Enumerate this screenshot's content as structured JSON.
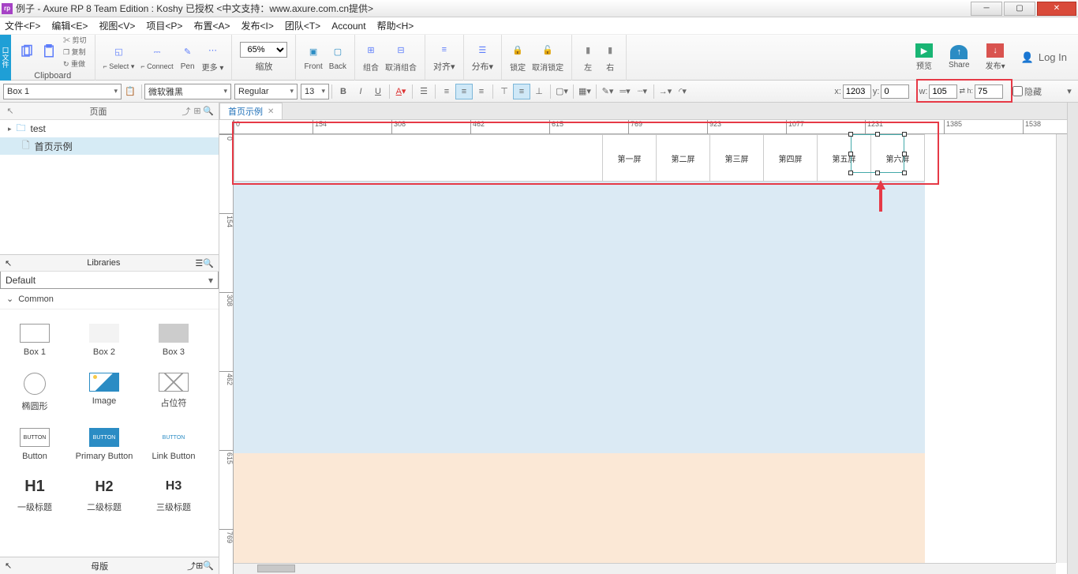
{
  "title": "例子 - Axure RP 8 Team Edition : Koshy 已授权    <中文支持：www.axure.com.cn提供>",
  "appicon": "rp",
  "menu": [
    "文件<F>",
    "编辑<E>",
    "视图<V>",
    "项目<P>",
    "布置<A>",
    "发布<I>",
    "团队<T>",
    "Account",
    "帮助<H>"
  ],
  "toolbar1": {
    "sidelabel": "口文件",
    "clipboard": "Clipboard",
    "clip_items": [
      "剪切",
      "复制",
      "重做"
    ],
    "select": "Select",
    "connect": "Connect",
    "pen": "Pen",
    "more": "更多 ▾",
    "zoom": "65%",
    "zoomlbl": "缩放",
    "front": "Front",
    "back": "Back",
    "group": "组合",
    "ungroup": "取消组合",
    "align": "对齐▾",
    "distribute": "分布▾",
    "lock": "锁定",
    "unlock": "取消锁定",
    "left": "左",
    "right": "右",
    "preview": "预览",
    "share": "Share",
    "publish": "发布▾",
    "login": "Log In"
  },
  "toolbar2": {
    "shape": "Box 1",
    "font": "微软雅黑",
    "weight": "Regular",
    "size": "13",
    "x_lbl": "x:",
    "x": "1203",
    "y_lbl": "y:",
    "y": "0",
    "w_lbl": "w:",
    "w": "105",
    "h_lbl": "h:",
    "h": "75",
    "hidden": "隐藏"
  },
  "pages": {
    "title": "页面",
    "items": [
      {
        "type": "folder",
        "name": "test"
      },
      {
        "type": "page",
        "name": "首页示例",
        "selected": true
      }
    ]
  },
  "libraries": {
    "title": "Libraries",
    "dd": "Default",
    "section": "Common",
    "items": [
      [
        "Box 1",
        "Box 2",
        "Box 3"
      ],
      [
        "椭圆形",
        "Image",
        "占位符"
      ],
      [
        "Button",
        "Primary Button",
        "Link Button"
      ],
      [
        "一级标题",
        "二级标题",
        "三级标题"
      ]
    ],
    "headings": [
      "H1",
      "H2",
      "H3"
    ],
    "btn": "BUTTON"
  },
  "master_title": "母版",
  "tab": "首页示例",
  "ruler_h": [
    "0",
    "154",
    "308",
    "462",
    "615",
    "769",
    "923",
    "1077",
    "1231",
    "1385",
    "1538"
  ],
  "ruler_v": [
    "0",
    "154",
    "308",
    "462",
    "615",
    "769"
  ],
  "nav_cells": [
    "第一屏",
    "第二屏",
    "第三屏",
    "第四屏",
    "第五屏",
    "第六屏"
  ]
}
